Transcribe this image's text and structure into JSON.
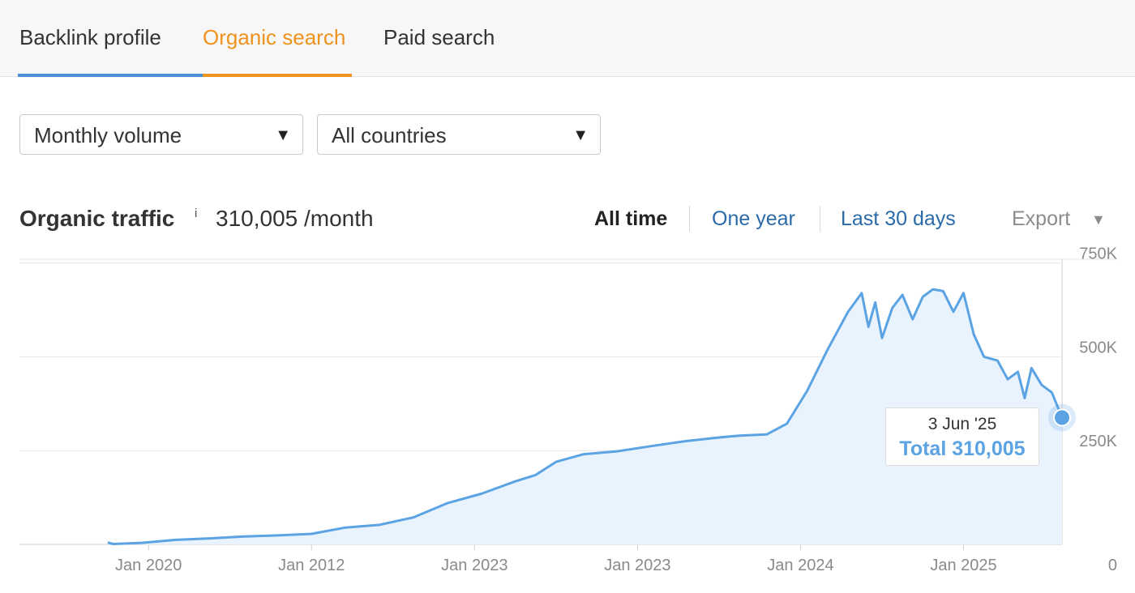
{
  "tabs": [
    {
      "label": "Backlink profile",
      "active": false
    },
    {
      "label": "Organic search",
      "active": true
    },
    {
      "label": "Paid search",
      "active": false
    }
  ],
  "filters": {
    "volume": "Monthly volume",
    "country": "All countries"
  },
  "header": {
    "title": "Organic traffic",
    "info_icon": "i",
    "total": "310,005 /month"
  },
  "ranges": {
    "all_time": "All time",
    "one_year": "One year",
    "last_30_days": "Last 30 days",
    "selected": "all_time"
  },
  "export": {
    "label": "Export",
    "caret": "▼"
  },
  "tooltip": {
    "date": "3 Jun '25",
    "total": "Total 310,005"
  },
  "colors": {
    "accent_orange": "#f0921e",
    "link_blue": "#2b6aa8",
    "line_blue": "#5ba3e2",
    "area_fill": "#e9f3fd"
  },
  "chart_data": {
    "type": "area",
    "series": [
      {
        "values": [
          [
            0.0,
            5000
          ],
          [
            0.08,
            1000
          ],
          [
            0.5,
            4000
          ],
          [
            1.0,
            12000
          ],
          [
            1.5,
            16000
          ],
          [
            2.0,
            21000
          ],
          [
            2.5,
            24000
          ],
          [
            3.0,
            28000
          ],
          [
            3.5,
            45000
          ],
          [
            4.0,
            52000
          ],
          [
            4.5,
            72000
          ],
          [
            5.0,
            110000
          ],
          [
            5.5,
            135000
          ],
          [
            6.0,
            168000
          ],
          [
            6.3,
            185000
          ],
          [
            6.6,
            220000
          ],
          [
            7.0,
            240000
          ],
          [
            7.5,
            248000
          ],
          [
            8.0,
            262000
          ],
          [
            8.5,
            275000
          ],
          [
            9.0,
            285000
          ],
          [
            9.3,
            290000
          ],
          [
            9.7,
            293000
          ],
          [
            10.0,
            322000
          ],
          [
            10.3,
            410000
          ],
          [
            10.6,
            520000
          ],
          [
            10.9,
            620000
          ],
          [
            11.1,
            670000
          ],
          [
            11.2,
            580000
          ],
          [
            11.3,
            645000
          ],
          [
            11.4,
            550000
          ],
          [
            11.55,
            630000
          ],
          [
            11.7,
            665000
          ],
          [
            11.85,
            600000
          ],
          [
            12.0,
            660000
          ],
          [
            12.15,
            680000
          ],
          [
            12.3,
            675000
          ],
          [
            12.45,
            620000
          ],
          [
            12.6,
            670000
          ],
          [
            12.75,
            560000
          ],
          [
            12.9,
            500000
          ],
          [
            13.1,
            490000
          ],
          [
            13.25,
            440000
          ],
          [
            13.4,
            460000
          ],
          [
            13.5,
            390000
          ],
          [
            13.6,
            470000
          ],
          [
            13.75,
            425000
          ],
          [
            13.9,
            405000
          ],
          [
            14.05,
            338000
          ]
        ]
      }
    ],
    "x_ticks": [
      {
        "at": 0.6,
        "label": "Jan 2020"
      },
      {
        "at": 3.0,
        "label": "Jan 2012"
      },
      {
        "at": 5.4,
        "label": "Jan 2023"
      },
      {
        "at": 7.8,
        "label": "Jan 2023"
      },
      {
        "at": 10.2,
        "label": "Jan 2024"
      },
      {
        "at": 12.6,
        "label": "Jan 2025"
      }
    ],
    "y_ticks": [
      {
        "value": 0,
        "label": "0"
      },
      {
        "value": 250000,
        "label": "250K"
      },
      {
        "value": 500000,
        "label": "500K"
      },
      {
        "value": 750000,
        "label": "750K"
      }
    ],
    "xlim": [
      -1.3,
      14.05
    ],
    "ylim": [
      0,
      760000
    ],
    "highlight": {
      "x": 14.05,
      "y": 338000
    },
    "grid": true
  }
}
